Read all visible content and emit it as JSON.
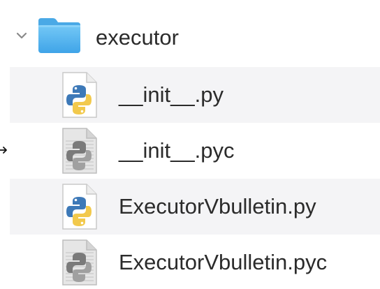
{
  "window": {
    "colors": {
      "stripe": "#f4f4f6",
      "text": "#2b2b2b",
      "folder_blue": "#5bb8f0"
    }
  },
  "folder": {
    "name": "executor",
    "expanded": true,
    "icon": "folder-icon"
  },
  "files": [
    {
      "name": "__init__.py",
      "icon": "python-file-icon"
    },
    {
      "name": "__init__.pyc",
      "icon": "python-compiled-file-icon"
    },
    {
      "name": "ExecutorVbulletin.py",
      "icon": "python-file-icon"
    },
    {
      "name": "ExecutorVbulletin.pyc",
      "icon": "python-compiled-file-icon"
    }
  ]
}
